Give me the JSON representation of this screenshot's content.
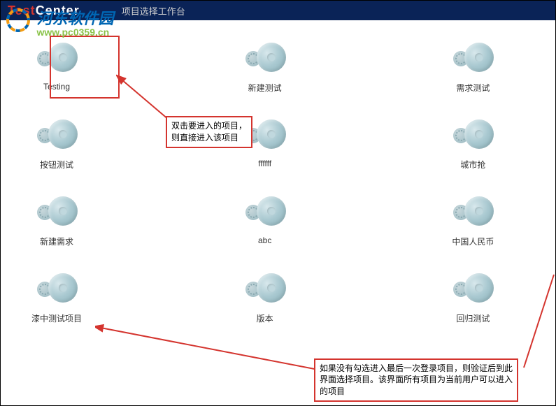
{
  "header": {
    "logo_red": "Test",
    "logo_white": "Center",
    "title": "项目选择工作台"
  },
  "watermark": {
    "name": "河东软件园",
    "url": "www.pc0359.cn"
  },
  "projects": [
    {
      "label": "Testing"
    },
    {
      "label": "新建测试"
    },
    {
      "label": "需求测试"
    },
    {
      "label": "按钮测试"
    },
    {
      "label": "ffffff"
    },
    {
      "label": "城市抢"
    },
    {
      "label": "新建需求"
    },
    {
      "label": "abc"
    },
    {
      "label": "中国人民币"
    },
    {
      "label": "漆中测试项目"
    },
    {
      "label": "版本"
    },
    {
      "label": "回归测试"
    }
  ],
  "callouts": {
    "c1": "双击要进入的项目，则直接进入该项目",
    "c2": "如果没有勾选进入最后一次登录项目，则验证后到此界面选择项目。该界面所有项目为当前用户可以进入的项目"
  }
}
